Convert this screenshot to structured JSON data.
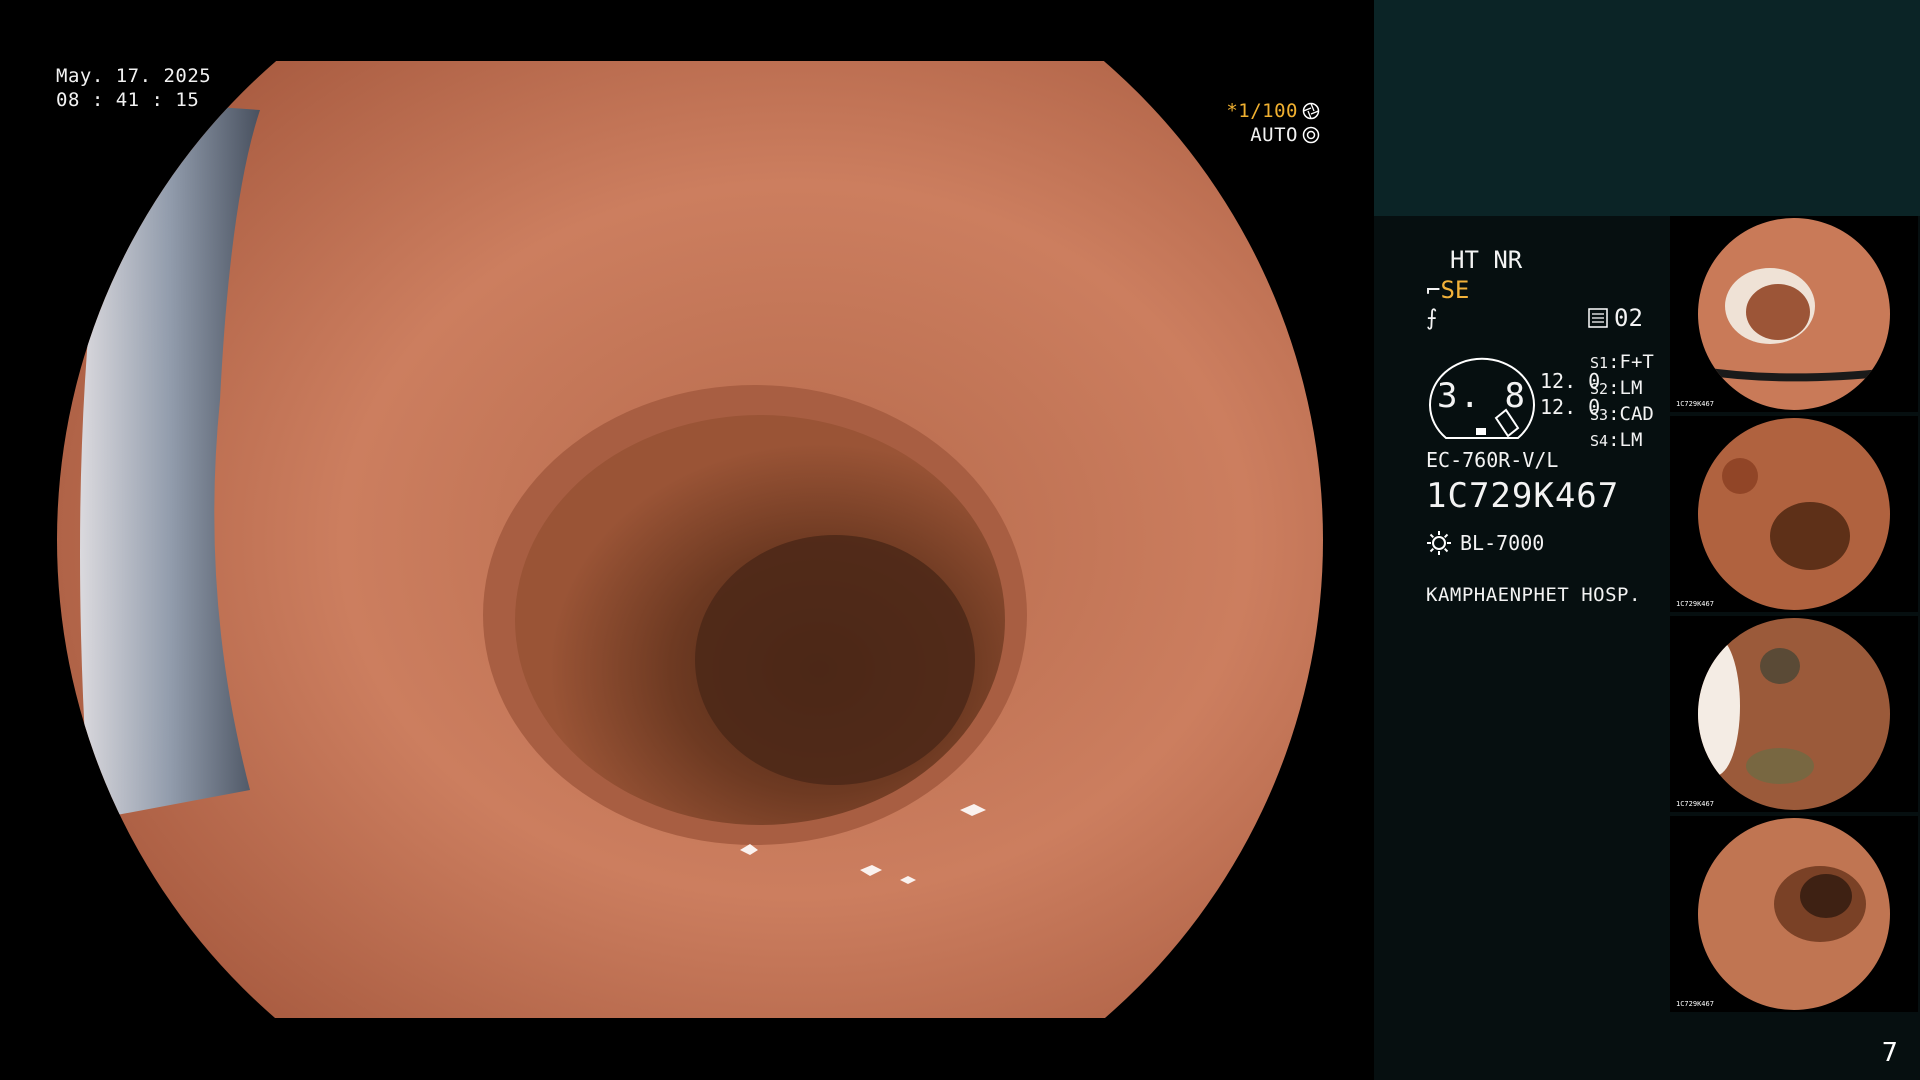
{
  "overlay": {
    "date": "May. 17. 2025",
    "time": "08 : 41 : 15",
    "shutter": "*1/100",
    "iris_mode": "AUTO"
  },
  "info": {
    "ht_nr": "HT NR",
    "se_label": "SE",
    "record_count": "02",
    "gauge_value": "3. 8",
    "enhancement": [
      "12. 0",
      "12. 0"
    ],
    "settings": [
      {
        "key": "S1",
        "value": "F+T"
      },
      {
        "key": "S2",
        "value": "LM"
      },
      {
        "key": "S3",
        "value": "CAD"
      },
      {
        "key": "S4",
        "value": "LM"
      }
    ],
    "scope_model": "EC-760R-V/L",
    "serial": "1C729K467",
    "light_source": "BL-7000",
    "hospital": "KAMPHAENPHET HOSP."
  },
  "thumbnails": [
    {
      "name": "thumbnail-1",
      "label": "1C729K467"
    },
    {
      "name": "thumbnail-2",
      "label": "1C729K467"
    },
    {
      "name": "thumbnail-3",
      "label": "1C729K467"
    },
    {
      "name": "thumbnail-4",
      "label": "1C729K467"
    }
  ],
  "page_number": "7",
  "colors": {
    "accent": "#f2b23a",
    "panel_bg": "#060f10",
    "panel_top": "#0b2426",
    "mucosa": "#c8785a"
  }
}
